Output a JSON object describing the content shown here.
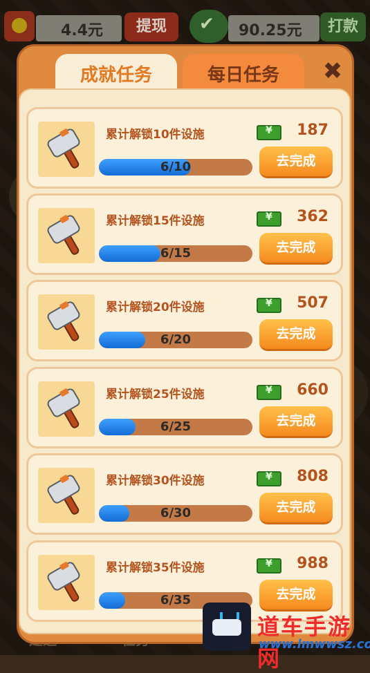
{
  "topbar": {
    "cash_value": "4.4元",
    "withdraw_label": "提现",
    "gem_value": "90.25元",
    "punch_label": "打款"
  },
  "tabs": [
    {
      "label": "成就任务",
      "active": true
    },
    {
      "label": "每日任务",
      "active": false
    }
  ],
  "tasks": [
    {
      "title": "累计解锁10件设施",
      "reward": "187",
      "progress_text": "6/10",
      "progress": 0.6,
      "button": "去完成"
    },
    {
      "title": "累计解锁15件设施",
      "reward": "362",
      "progress_text": "6/15",
      "progress": 0.4,
      "button": "去完成"
    },
    {
      "title": "累计解锁20件设施",
      "reward": "507",
      "progress_text": "6/20",
      "progress": 0.3,
      "button": "去完成"
    },
    {
      "title": "累计解锁25件设施",
      "reward": "660",
      "progress_text": "6/25",
      "progress": 0.24,
      "button": "去完成"
    },
    {
      "title": "累计解锁30件设施",
      "reward": "808",
      "progress_text": "6/30",
      "progress": 0.2,
      "button": "去完成"
    },
    {
      "title": "累计解锁35件设施",
      "reward": "988",
      "progress_text": "6/35",
      "progress": 0.171,
      "button": "去完成"
    }
  ],
  "bottom": {
    "left_label": "建造",
    "mid_label": "任务"
  },
  "watermark": {
    "text": "道车手游网",
    "url": "www.lmwwsz.com"
  },
  "colors": {
    "panel": "#df8a3f",
    "accent": "#e07a25",
    "progress": "#2a86ea",
    "button": "#f68a1e"
  }
}
